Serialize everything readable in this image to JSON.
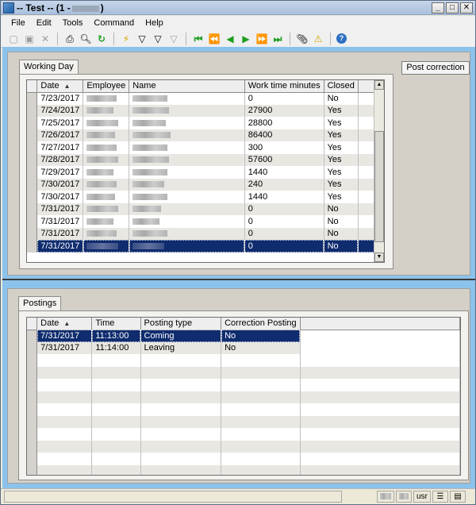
{
  "window": {
    "title": "-- Test -- (1 -",
    "title_suffix": ")"
  },
  "menu": [
    "File",
    "Edit",
    "Tools",
    "Command",
    "Help"
  ],
  "toolbar": {
    "icons": [
      "new-icon",
      "save-icon",
      "delete-icon",
      "print-icon",
      "print-preview-icon",
      "refresh-icon",
      "filter-by-selection-icon",
      "advanced-filter-icon",
      "filter-by-field-icon",
      "remove-filter-icon",
      "first-record-icon",
      "previous-page-icon",
      "previous-record-icon",
      "next-record-icon",
      "next-page-icon",
      "last-record-icon",
      "document-handling-icon",
      "alert-icon",
      "help-icon"
    ]
  },
  "top_tab": {
    "label": "Working Day"
  },
  "post_correction_label": "Post correction",
  "working_day": {
    "columns": [
      "Date",
      "Employee",
      "Name",
      "Work time minutes",
      "Closed"
    ],
    "rows": [
      {
        "date": "7/23/2017",
        "minutes": "0",
        "closed": "No"
      },
      {
        "date": "7/24/2017",
        "minutes": "27900",
        "closed": "Yes"
      },
      {
        "date": "7/25/2017",
        "minutes": "28800",
        "closed": "Yes"
      },
      {
        "date": "7/26/2017",
        "minutes": "86400",
        "closed": "Yes"
      },
      {
        "date": "7/27/2017",
        "minutes": "300",
        "closed": "Yes"
      },
      {
        "date": "7/28/2017",
        "minutes": "57600",
        "closed": "Yes"
      },
      {
        "date": "7/29/2017",
        "minutes": "1440",
        "closed": "Yes"
      },
      {
        "date": "7/30/2017",
        "minutes": "240",
        "closed": "Yes"
      },
      {
        "date": "7/30/2017",
        "minutes": "1440",
        "closed": "Yes"
      },
      {
        "date": "7/31/2017",
        "minutes": "0",
        "closed": "No"
      },
      {
        "date": "7/31/2017",
        "minutes": "0",
        "closed": "No"
      },
      {
        "date": "7/31/2017",
        "minutes": "0",
        "closed": "No"
      },
      {
        "date": "7/31/2017",
        "minutes": "0",
        "closed": "No"
      }
    ],
    "selected_row_index": 12
  },
  "bottom_tab": {
    "label": "Postings"
  },
  "postings": {
    "columns": [
      "Date",
      "Time",
      "Posting type",
      "Correction Posting"
    ],
    "rows": [
      {
        "date": "7/31/2017",
        "time": "11:13:00",
        "type": "Coming",
        "correction": "No"
      },
      {
        "date": "7/31/2017",
        "time": "11:14:00",
        "type": "Leaving",
        "correction": "No"
      }
    ],
    "selected_row_index": 0
  },
  "status": {
    "user": "usr"
  }
}
